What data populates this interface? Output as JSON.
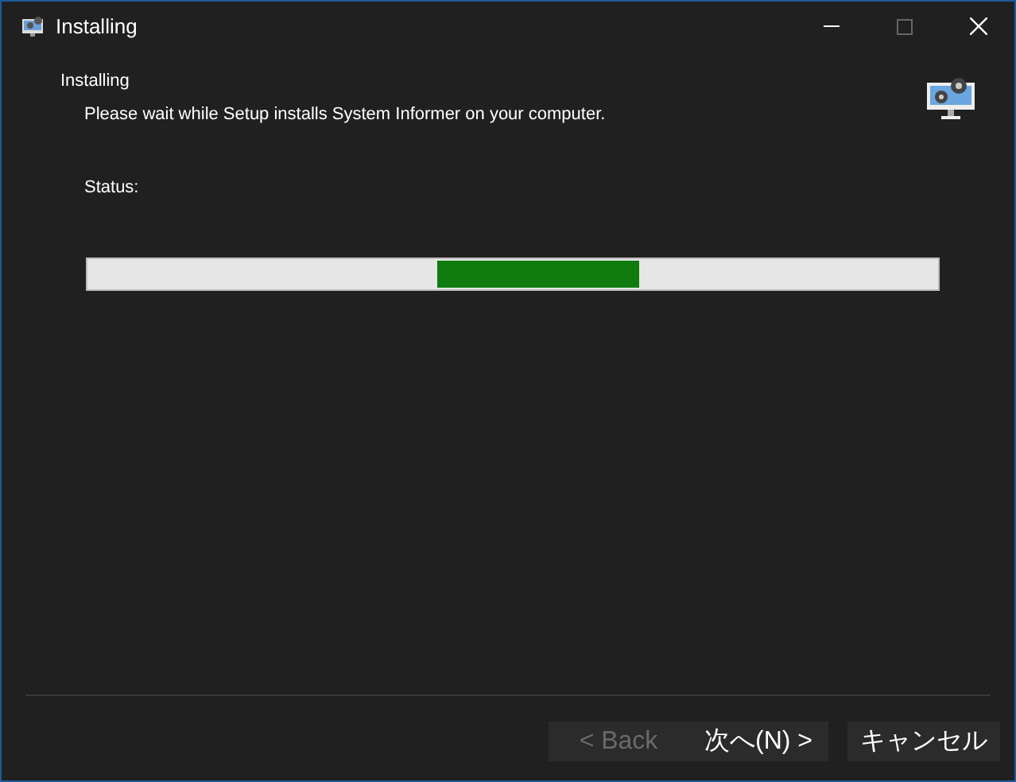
{
  "window": {
    "title": "Installing"
  },
  "header": {
    "title": "Installing",
    "subtitle": "Please wait while Setup installs System Informer on your computer."
  },
  "status": {
    "label": "Status:"
  },
  "progress": {
    "indeterminate": true
  },
  "buttons": [
    {
      "label": "< Back",
      "disabled": true
    },
    {
      "label": "次へ(N) >",
      "disabled": false
    },
    {
      "label": "キャンセル",
      "disabled": false
    }
  ]
}
